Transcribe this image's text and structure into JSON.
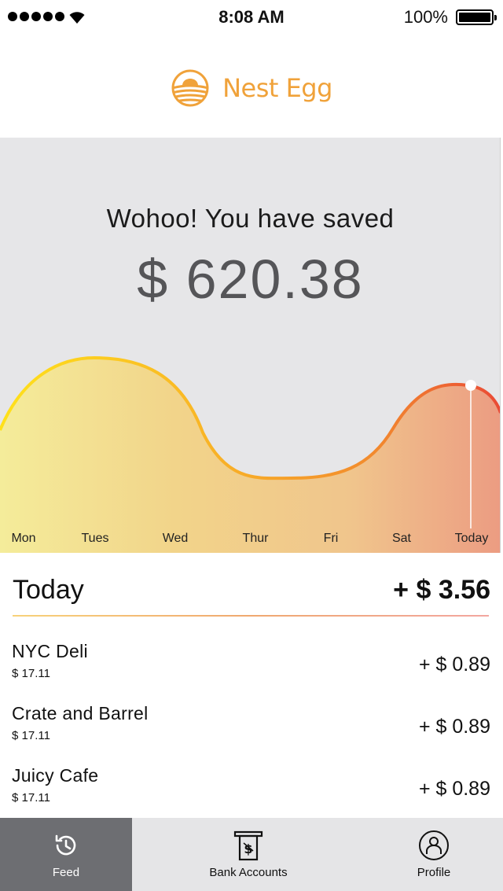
{
  "status_bar": {
    "time": "8:08 AM",
    "battery_percent": "100%",
    "signal_bars": 5,
    "icons": [
      "signal-dots-icon",
      "wifi-icon",
      "battery-icon"
    ]
  },
  "header": {
    "app_name": "Nest Egg",
    "logo_icon": "nest-egg-logo-icon",
    "brand_color": "#f0a23a"
  },
  "hero": {
    "heading": "Wohoo! You have saved",
    "amount": "$ 620.38"
  },
  "chart_data": {
    "type": "area",
    "categories": [
      "Mon",
      "Tues",
      "Wed",
      "Thur",
      "Fri",
      "Sat",
      "Today"
    ],
    "highlighted": "Today",
    "gradient_colors": [
      "#ffd400",
      "#f5a623",
      "#ef5a3a"
    ]
  },
  "today": {
    "label": "Today",
    "total": "+ $ 3.56"
  },
  "transactions": [
    {
      "name": "NYC Deli",
      "spent": "$ 17.11",
      "saved": "+ $ 0.89"
    },
    {
      "name": "Crate and Barrel",
      "spent": "$ 17.11",
      "saved": "+ $ 0.89"
    },
    {
      "name": "Juicy Cafe",
      "spent": "$ 17.11",
      "saved": "+ $ 0.89"
    }
  ],
  "tabs": [
    {
      "label": "Feed",
      "icon": "history-icon",
      "active": true
    },
    {
      "label": "Bank Accounts",
      "icon": "atm-cash-icon",
      "active": false
    },
    {
      "label": "Profile",
      "icon": "user-icon",
      "active": false
    }
  ]
}
